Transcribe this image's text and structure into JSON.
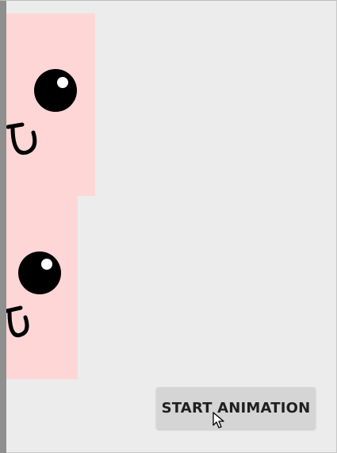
{
  "button": {
    "label": "START ANIMATION"
  },
  "icons": {
    "tile_faces": "cartoon-face-icon",
    "cursor": "mouse-pointer-icon"
  },
  "colors": {
    "background": "#ececec",
    "tile": "#ffd6d6",
    "button": "#d5d5d5",
    "edge": "#8f8f8f"
  }
}
